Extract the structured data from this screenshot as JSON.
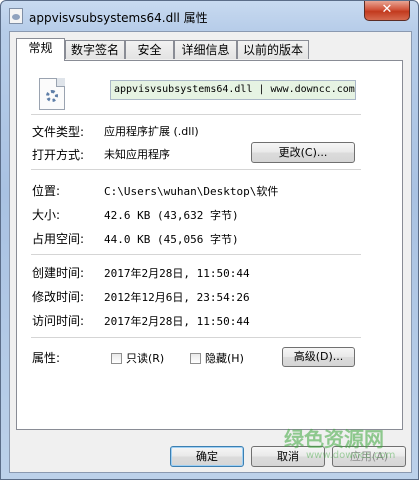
{
  "window": {
    "title": "appvisvsubsystems64.dll 属性",
    "close_label": "✕"
  },
  "tabs": [
    {
      "label": "常规",
      "active": true
    },
    {
      "label": "数字签名",
      "active": false
    },
    {
      "label": "安全",
      "active": false
    },
    {
      "label": "详细信息",
      "active": false
    },
    {
      "label": "以前的版本",
      "active": false
    }
  ],
  "general": {
    "file_name": "appvisvsubsystems64.dll | www.downcc.com",
    "file_type_label": "文件类型:",
    "file_type_value": "应用程序扩展 (.dll)",
    "opens_with_label": "打开方式:",
    "opens_with_value": "未知应用程序",
    "change_button": "更改(C)...",
    "location_label": "位置:",
    "location_value": "C:\\Users\\wuhan\\Desktop\\软件",
    "size_label": "大小:",
    "size_value": "42.6 KB (43,632 字节)",
    "size_on_disk_label": "占用空间:",
    "size_on_disk_value": "44.0 KB (45,056 字节)",
    "created_label": "创建时间:",
    "created_value": "2017年2月28日, 11:50:44",
    "modified_label": "修改时间:",
    "modified_value": "2012年12月6日, 23:54:26",
    "accessed_label": "访问时间:",
    "accessed_value": "2017年2月28日, 11:50:44",
    "attributes_label": "属性:",
    "readonly_label": "只读(R)",
    "hidden_label": "隐藏(H)",
    "advanced_button": "高级(D)..."
  },
  "footer": {
    "ok_button": "确定",
    "cancel_button": "取消",
    "apply_button": "应用(A)"
  },
  "watermark": {
    "text": "绿色资源网",
    "url": "www.downcc.com"
  },
  "icons": {
    "title_icon": "dll-file-icon",
    "file_icon": "dll-file-gear-icon"
  }
}
